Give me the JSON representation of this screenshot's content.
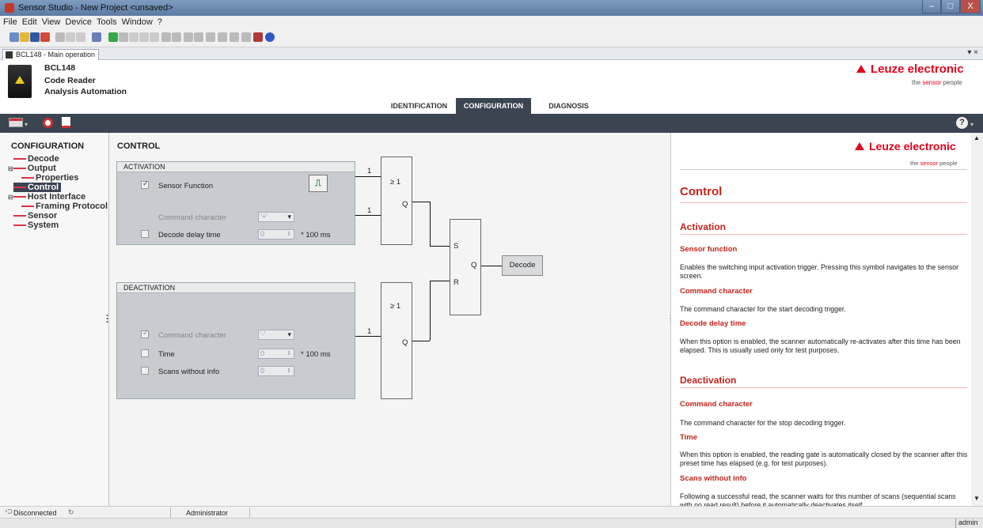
{
  "window": {
    "title": "Sensor Studio - New Project  <unsaved>",
    "min": "–",
    "max": "□",
    "close": "X"
  },
  "menu": [
    "File",
    "Edit",
    "View",
    "Device",
    "Tools",
    "Window",
    "?"
  ],
  "doc_tab": {
    "label": "BCL148 - Main operation",
    "close": "▾ ×"
  },
  "device": {
    "name": "BCL148",
    "type": "Code Reader",
    "vendor": "Analysis Automation"
  },
  "brand": {
    "name": "Leuze electronic",
    "tag_pre": "the",
    "tag_accent": "sensor",
    "tag_post": "people"
  },
  "nav_tabs": [
    "IDENTIFICATION",
    "CONFIGURATION",
    "DIAGNOSIS"
  ],
  "nav_active": 1,
  "help_icon": "?",
  "tree": {
    "title": "CONFIGURATION",
    "items": [
      "Decode",
      "Output",
      "Properties",
      "Control",
      "Host Interface",
      "Framing Protocol",
      "Sensor",
      "System"
    ],
    "selected": 3
  },
  "control": {
    "title": "CONTROL",
    "activation": {
      "header": "ACTIVATION",
      "sensor_function": "Sensor Function",
      "command_character": "Command character",
      "command_value": "'+'",
      "decode_delay": "Decode delay time",
      "decode_delay_value": "0",
      "unit": "* 100 ms"
    },
    "deactivation": {
      "header": "DEACTIVATION",
      "command_character": "Command character",
      "command_value": "'-'",
      "time": "Time",
      "time_value": "0",
      "unit": "* 100 ms",
      "scans": "Scans without info",
      "scans_value": "0"
    },
    "logic": {
      "in1": "1",
      "in2": "1",
      "in3": "1",
      "or1": "≥ 1",
      "or2": "≥ 1",
      "q": "Q",
      "s": "S",
      "r": "R",
      "decode": "Decode"
    }
  },
  "help": {
    "title": "Control",
    "activation": "Activation",
    "sensor_function_h": "Sensor function",
    "sensor_function_t": "Enables the switching input activation trigger. Pressing this symbol navigates to the sensor screen.",
    "cmd_char_h": "Command character",
    "cmd_char_t": "The command character for the start decoding trigger.",
    "delay_h": "Decode delay time",
    "delay_t": "When this option is enabled, the scanner automatically re-activates after this time has been elapsed. This is usually used only for test purposes.",
    "deactivation": "Deactivation",
    "d_cmd_h": "Command character",
    "d_cmd_t": "The command character for the stop decoding trigger.",
    "time_h": "Time",
    "time_t": "When this option is enabled, the reading gate is automatically closed by the scanner after this preset time has elapsed (e.g. for test purposes).",
    "scans_h": "Scans without info",
    "scans_t": "Following a successful read, the scanner waits for this number of scans (sequential scans with no read result) before it automatically deactivates itself."
  },
  "status": {
    "connection": "Disconnected",
    "user": "Administrator",
    "role": "admin"
  },
  "colors": {
    "brand_red": "#e2001a",
    "help_red": "#c0241b",
    "bar": "#3b4451"
  }
}
